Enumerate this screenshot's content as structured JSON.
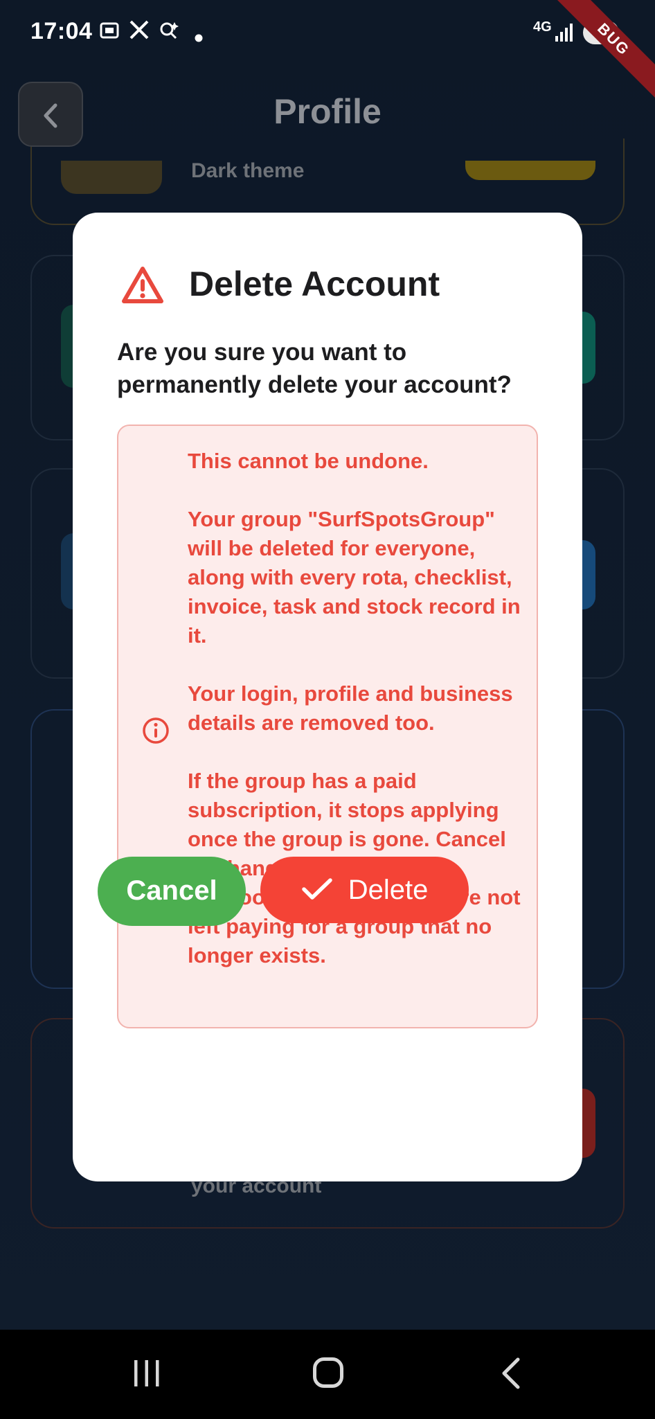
{
  "status_bar": {
    "time": "17:04",
    "network": "4G",
    "battery": "65",
    "debug_banner": "BUG"
  },
  "app_bar": {
    "title": "Profile",
    "back_icon": "chevron-left-icon"
  },
  "background": {
    "dark_theme_label": "Dark theme",
    "account_label": "your account"
  },
  "dialog": {
    "title": "Delete Account",
    "question": "Are you sure you want to permanently delete your account?",
    "warning_paragraphs": [
      "This cannot be undone.",
      "Your group \"SurfSpotsGroup\" will be deleted for everyone, along with every rota, checklist, invoice, task and stock record in it.",
      "Your login, profile and business details are removed too.",
      "If the group has a paid subscription, it stops applying once the group is gone. Cancel or change the plan at busitools.net first so you are not left paying for a group that no longer exists."
    ],
    "cancel_label": "Cancel",
    "delete_label": "Delete",
    "colors": {
      "danger": "#f44336",
      "success": "#4caf50",
      "warning_text": "#e8493d",
      "warning_bg": "#fdeceb"
    }
  },
  "nav_bar": {
    "recent_icon": "recent-apps-icon",
    "home_icon": "home-icon",
    "back_icon": "back-icon"
  }
}
